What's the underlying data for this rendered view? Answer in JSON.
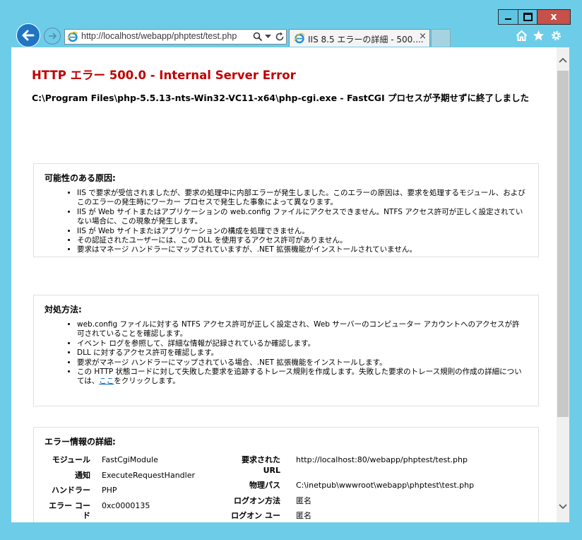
{
  "window": {
    "close_glyph": "x"
  },
  "browser": {
    "address_url": "http://localhost/webapp/phptest/test.php",
    "tab_title": "IIS 8.5 エラーの詳細 - 500....",
    "tab_close": "×"
  },
  "page": {
    "title": "HTTP エラー 500.0 - Internal Server Error",
    "subtitle": "C:\\Program Files\\php-5.5.13-nts-Win32-VC11-x64\\php-cgi.exe - FastCGI プロセスが予期せずに終了しました",
    "causes": {
      "heading": "可能性のある原因:",
      "items": [
        "IIS で要求が受信されましたが、要求の処理中に内部エラーが発生しました。このエラーの原因は、要求を処理するモジュール、およびこのエラーの発生時にワーカー プロセスで発生した事象によって異なります。",
        "IIS が Web サイトまたはアプリケーションの web.config ファイルにアクセスできません。NTFS アクセス許可が正しく設定されていない場合に、この現象が発生します。",
        "IIS が Web サイトまたはアプリケーションの構成を処理できません。",
        "その認証されたユーザーには、この DLL を使用するアクセス許可がありません。",
        "要求はマネージ ハンドラーにマップされていますが、.NET 拡張機能がインストールされていません。"
      ]
    },
    "actions": {
      "heading": "対処方法:",
      "items": [
        "web.config ファイルに対する NTFS アクセス許可が正しく設定され、Web サーバーのコンピューター アカウントへのアクセスが許可されていることを確認します。",
        "イベント ログを参照して、詳細な情報が記録されているか確認します。",
        "DLL に対するアクセス許可を確認します。",
        "要求がマネージ ハンドラーにマップされている場合、.NET 拡張機能をインストールします。"
      ],
      "last_item_before": "この HTTP 状態コードに対して失敗した要求を追跡するトレース規則を作成します。失敗した要求のトレース規則の作成の詳細については、",
      "last_item_link": "ここ",
      "last_item_after": "をクリックします。"
    },
    "details": {
      "heading": "エラー情報の詳細:",
      "left": [
        {
          "label": "モジュール",
          "value": "FastCgiModule"
        },
        {
          "label": "通知",
          "value": "ExecuteRequestHandler"
        },
        {
          "label": "ハンドラー",
          "value": "PHP"
        },
        {
          "label": "エラー コード",
          "value": "0xc0000135"
        }
      ],
      "right": [
        {
          "label": "要求された URL",
          "value": "http://localhost:80/webapp/phptest/test.php"
        },
        {
          "label": "物理パス",
          "value": "C:\\inetpub\\wwwroot\\webapp\\phptest\\test.php"
        },
        {
          "label": "ログオン方法",
          "value": "匿名"
        },
        {
          "label": "ログオン ユーザー",
          "value": "匿名"
        }
      ]
    }
  }
}
